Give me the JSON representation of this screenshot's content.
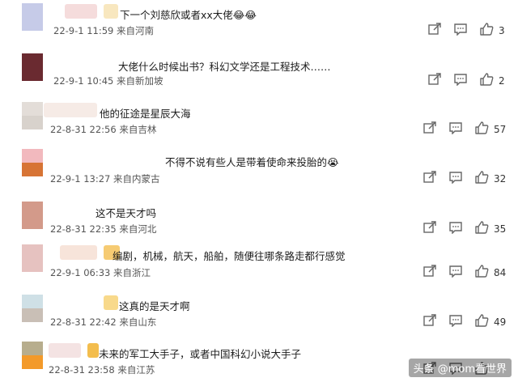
{
  "comments": [
    {
      "text": "下一个刘慈欣或者xx大佬😂😂",
      "meta": "22-9-1 11:59 来自河南",
      "likes": "3",
      "avatar": [
        "#c6cbe8",
        "#c6cbe8"
      ],
      "blurs": [
        "#f3d6d6",
        "#f7e3b4"
      ]
    },
    {
      "text": "大佬什么时候出书？科幻文学还是工程技术……",
      "meta": "22-9-1 10:45 来自新加坡",
      "likes": "2",
      "avatar": [
        "#6a2a30",
        "#6a2a30"
      ],
      "blurs": []
    },
    {
      "text": "他的征途是星辰大海",
      "meta": "22-8-31 22:56 来自吉林",
      "likes": "57",
      "avatar": [
        "#e3ddd8",
        "#d8d2cc"
      ],
      "blurs": [
        "#f5e7e2"
      ]
    },
    {
      "text": "不得不说有些人是带着使命来投胎的😭",
      "meta": "22-9-1 13:27 来自内蒙古",
      "likes": "32",
      "avatar": [
        "#f2b9be",
        "#d77435"
      ],
      "blurs": []
    },
    {
      "text": "这不是天才吗",
      "meta": "22-8-31 22:35 来自河北",
      "likes": "35",
      "avatar": [
        "#d39a8a",
        "#d39a8a"
      ],
      "blurs": []
    },
    {
      "text": "编剧，机械，航天，船舶，随便往哪条路走都行感觉",
      "meta": "22-9-1 06:33 来自浙江",
      "likes": "84",
      "avatar": [
        "#e6c2c0",
        "#e6c2c0"
      ],
      "blurs": [
        "#f6dfd4",
        "#f4c25a"
      ]
    },
    {
      "text": "这真的是天才啊",
      "meta": "22-8-31 22:42 来自山东",
      "likes": "49",
      "avatar": [
        "#cfe0e6",
        "#c9bfb6"
      ],
      "blurs": [
        "#f7d277"
      ]
    },
    {
      "text": "未来的军工大手子，或者中国科幻小说大手子",
      "meta": "22-8-31 23:58 来自江苏",
      "likes": "",
      "avatar": [
        "#b7ad8d",
        "#f39a2a"
      ],
      "blurs": [
        "#f2dede",
        "#f1b12e"
      ]
    }
  ],
  "icons": {
    "share": "share-icon",
    "comment": "comment-icon",
    "like": "thumbs-up-icon"
  },
  "watermark": "头条 @mom看世界"
}
